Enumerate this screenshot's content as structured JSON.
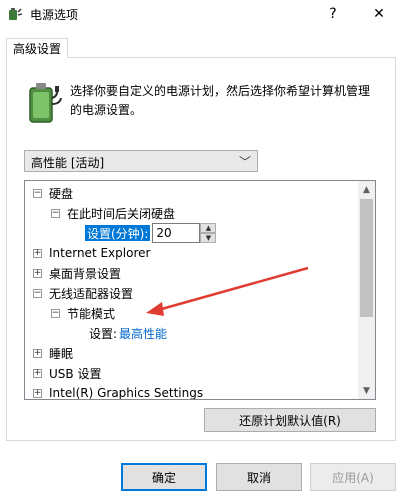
{
  "window": {
    "title": "电源选项",
    "help_label": "?",
    "close_label": "✕",
    "icon": "power-options-icon"
  },
  "tabs": [
    {
      "label": "高级设置"
    }
  ],
  "description": "选择你要自定义的电源计划，然后选择你希望计算机管理的电源设置。",
  "plan_select": {
    "value": "高性能 [活动]"
  },
  "tree": {
    "harddisk": {
      "label": "硬盘",
      "expand": "⊟"
    },
    "turn_off": {
      "label": "在此时间后关闭硬盘",
      "expand": "⊟"
    },
    "setting_label": "设置(分钟):",
    "setting_value": "20",
    "ie": {
      "label": "Internet Explorer",
      "expand": "⊞"
    },
    "desktop": {
      "label": "桌面背景设置",
      "expand": "⊞"
    },
    "wireless": {
      "label": "无线适配器设置",
      "expand": "⊟"
    },
    "power_save": {
      "label": "节能模式",
      "expand": "⊟"
    },
    "power_save_setting_label": "设置:",
    "power_save_setting_value": "最高性能",
    "sleep": {
      "label": "睡眠",
      "expand": "⊞"
    },
    "usb": {
      "label": "USB 设置",
      "expand": "⊞"
    },
    "intel": {
      "label": "Intel(R) Graphics Settings",
      "expand": "⊞"
    }
  },
  "restore_button": "还原计划默认值(R)",
  "buttons": {
    "ok": "确定",
    "cancel": "取消",
    "apply": "应用(A)"
  },
  "colors": {
    "accent": "#0078d7",
    "link": "#0066cc",
    "annotation": "#e03c31"
  }
}
